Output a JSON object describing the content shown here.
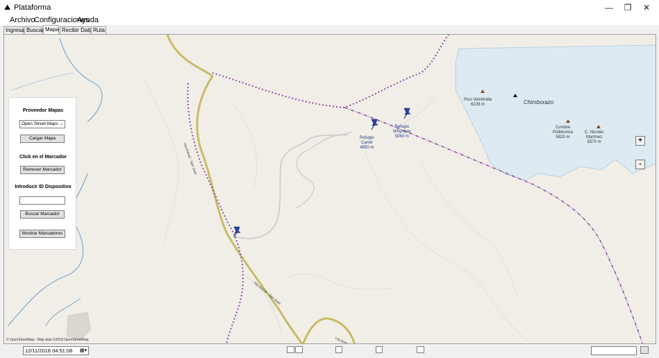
{
  "window": {
    "title": "Plataforma",
    "controls": {
      "minimize": "—",
      "maximize": "❐",
      "close": "✕"
    }
  },
  "menu": [
    "Archivo",
    "Configuraciones",
    "Ayuda"
  ],
  "tabs": [
    "Ingresar",
    "Buscar",
    "Mapa",
    "Recibir Datos",
    "Ruta"
  ],
  "active_tab": "Mapa",
  "panel": {
    "provider_heading": "Proveedor Mapas",
    "provider_selected": "Open Street Maps",
    "load_button": "Cargar Mapa",
    "marker_heading": "Click en el Marcador",
    "remove_button": "Remover Marcador",
    "device_heading": "Introducir ID Dispositivo",
    "device_value": "",
    "search_button": "Buscar Marcador",
    "show_button": "Mostrar Marcadores"
  },
  "map": {
    "places": {
      "chimborazo": "Chimborazo",
      "veintimilla": "Pico Veintimilla\n6228 m",
      "cumbre": "Cumbre\nPolitécnica\n5820 m",
      "nicolas": "C. Nicolás\nMartínez\n5570 m",
      "carrel": "Refugio\nCarrel\n4850 m",
      "whymper": "Refugio\nWhymper\n5060 m"
    },
    "road_labels": [
      "Vía Arenal - San Juan",
      "Vía Arenal - San Juan",
      "Vía Arenal"
    ],
    "copyright": "© OpenStreetMap - Map data ©2018 OpenStreetMap",
    "zoom_in": "+",
    "zoom_out": "-"
  },
  "status": {
    "datetime": "12/11/2018 04:51:08"
  },
  "colors": {
    "map_background": "#f1eee8",
    "glacier": "#ddeaf1",
    "boundary": "#8f4aa6",
    "road": "#c7bb63",
    "water": "#7aa6c9",
    "marker": "#2a42a8"
  }
}
